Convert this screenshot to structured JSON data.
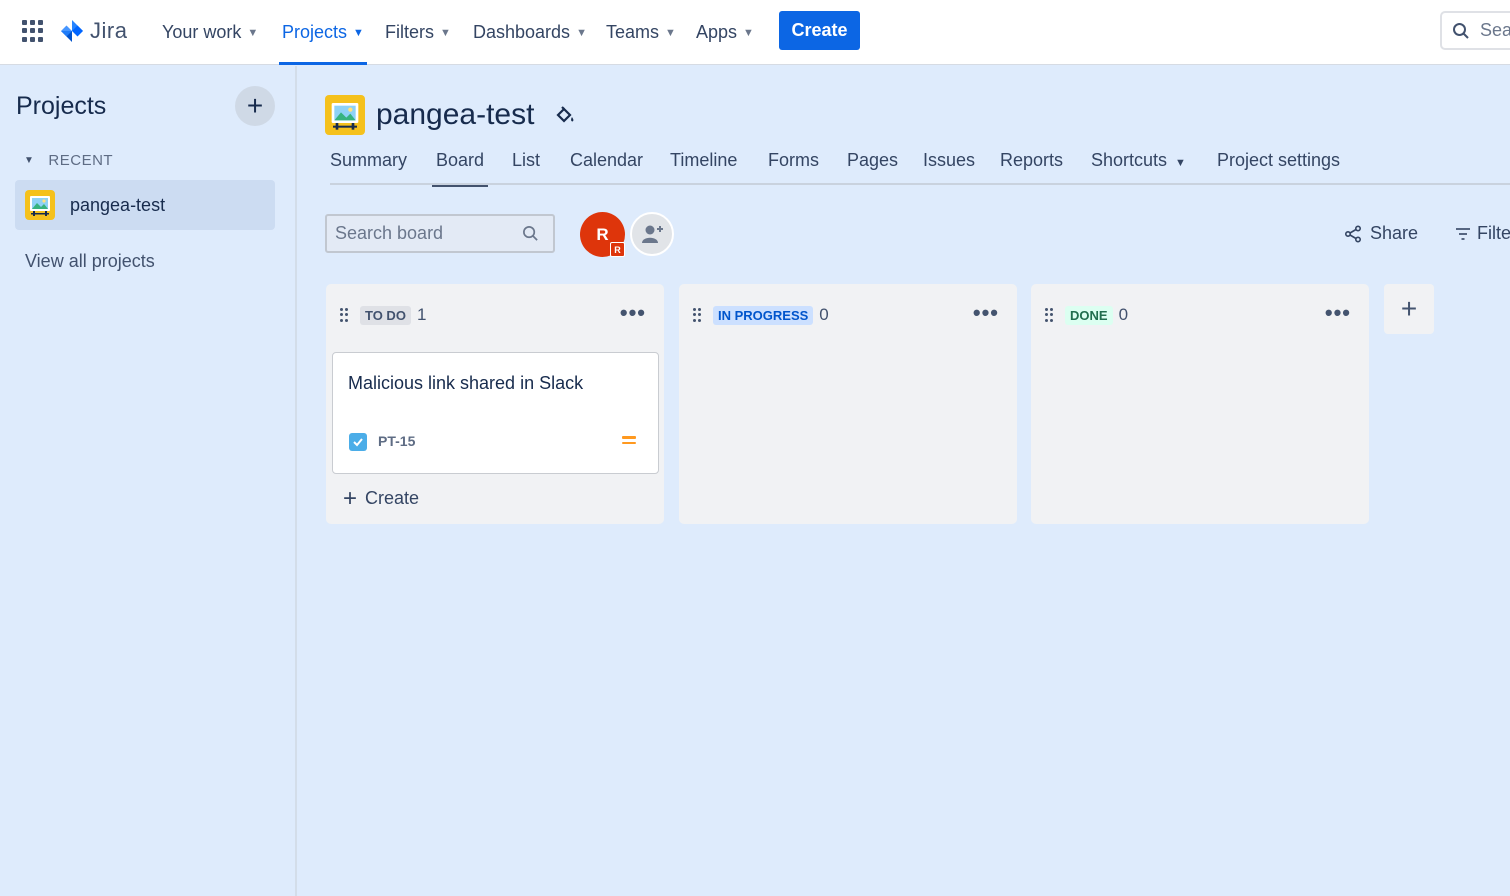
{
  "topnav": {
    "brand": "Jira",
    "items": [
      {
        "label": "Your work"
      },
      {
        "label": "Projects"
      },
      {
        "label": "Filters"
      },
      {
        "label": "Dashboards"
      },
      {
        "label": "Teams"
      },
      {
        "label": "Apps"
      }
    ],
    "create_label": "Create",
    "search_placeholder": "Sea"
  },
  "sidebar": {
    "title": "Projects",
    "section_label": "RECENT",
    "project_name": "pangea-test",
    "view_all_label": "View all projects"
  },
  "project": {
    "name": "pangea-test",
    "tabs": [
      {
        "label": "Summary"
      },
      {
        "label": "Board"
      },
      {
        "label": "List"
      },
      {
        "label": "Calendar"
      },
      {
        "label": "Timeline"
      },
      {
        "label": "Forms"
      },
      {
        "label": "Pages"
      },
      {
        "label": "Issues"
      },
      {
        "label": "Reports"
      },
      {
        "label": "Shortcuts"
      },
      {
        "label": "Project settings"
      }
    ],
    "active_tab": "Board"
  },
  "toolbar": {
    "search_placeholder": "Search board",
    "avatar_initial": "R",
    "avatar_sub_initial": "R",
    "share_label": "Share",
    "filter_label": "Filte"
  },
  "columns": [
    {
      "status": "TO DO",
      "count": "1",
      "color": "#dfe1e6"
    },
    {
      "status": "IN PROGRESS",
      "count": "0",
      "color": "#cce0ff"
    },
    {
      "status": "DONE",
      "count": "0",
      "color": "#dcfff1"
    }
  ],
  "card": {
    "title": "Malicious link shared in Slack",
    "key": "PT-15",
    "priority": "medium",
    "type": "task"
  },
  "create_in_column_label": "Create",
  "colors": {
    "accent": "#0c66e4",
    "page_bg": "#deebfc",
    "avatar": "#de350b",
    "project_icon": "#f5c11c",
    "priority_medium": "#ff991f"
  }
}
